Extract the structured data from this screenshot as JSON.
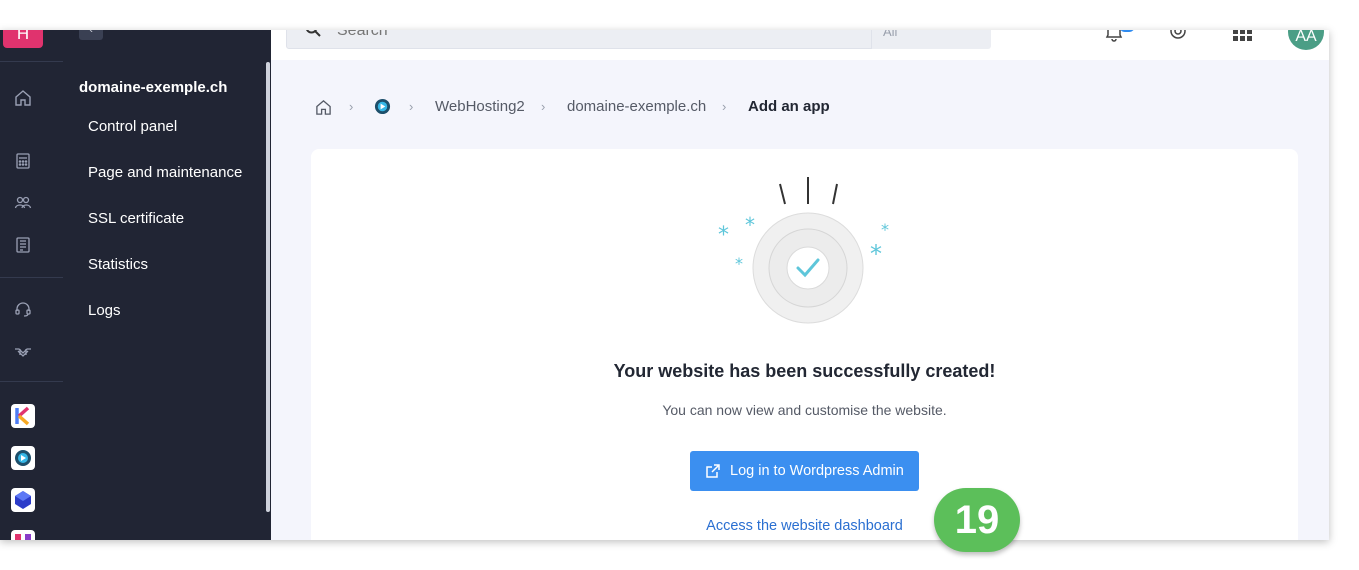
{
  "rail": {
    "logo_text": "H",
    "icons": [
      "home-icon",
      "calculator-icon",
      "users-icon",
      "invoice-icon",
      "headset-icon",
      "collaboration-icon"
    ],
    "apps": [
      {
        "name": "kchat-app-icon",
        "color": "#e7f1ff"
      },
      {
        "name": "web-hosting-app-icon",
        "color": "#ffffff"
      },
      {
        "name": "cube-app-icon",
        "color": "#ffffff"
      },
      {
        "name": "partial-app-icon",
        "color": "#ffffff"
      }
    ]
  },
  "sidebar": {
    "collapse_label": "‹",
    "domain": "domaine-exemple.ch",
    "items": [
      {
        "label": "Control panel"
      },
      {
        "label": "Page and maintenance"
      },
      {
        "label": "SSL certificate"
      },
      {
        "label": "Statistics"
      },
      {
        "label": "Logs"
      }
    ]
  },
  "topbar": {
    "search_placeholder": "Search",
    "search_scope": "All",
    "avatar_initials": "AA",
    "icons": [
      "bell-icon",
      "help-icon",
      "apps-grid-icon"
    ]
  },
  "breadcrumb": {
    "items": [
      "WebHosting2",
      "domaine-exemple.ch"
    ],
    "current": "Add an app"
  },
  "card": {
    "title": "Your website has been successfully created!",
    "subtitle": "You can now view and customise the website.",
    "primary_button": "Log in to Wordpress Admin",
    "link": "Access the website dashboard"
  },
  "step_badge": "19",
  "colors": {
    "sidebar_bg": "#212534",
    "primary": "#3b8ff0",
    "link": "#2a6fd1",
    "success_accent": "#5ec6da",
    "badge_green": "#5cbf5a"
  }
}
